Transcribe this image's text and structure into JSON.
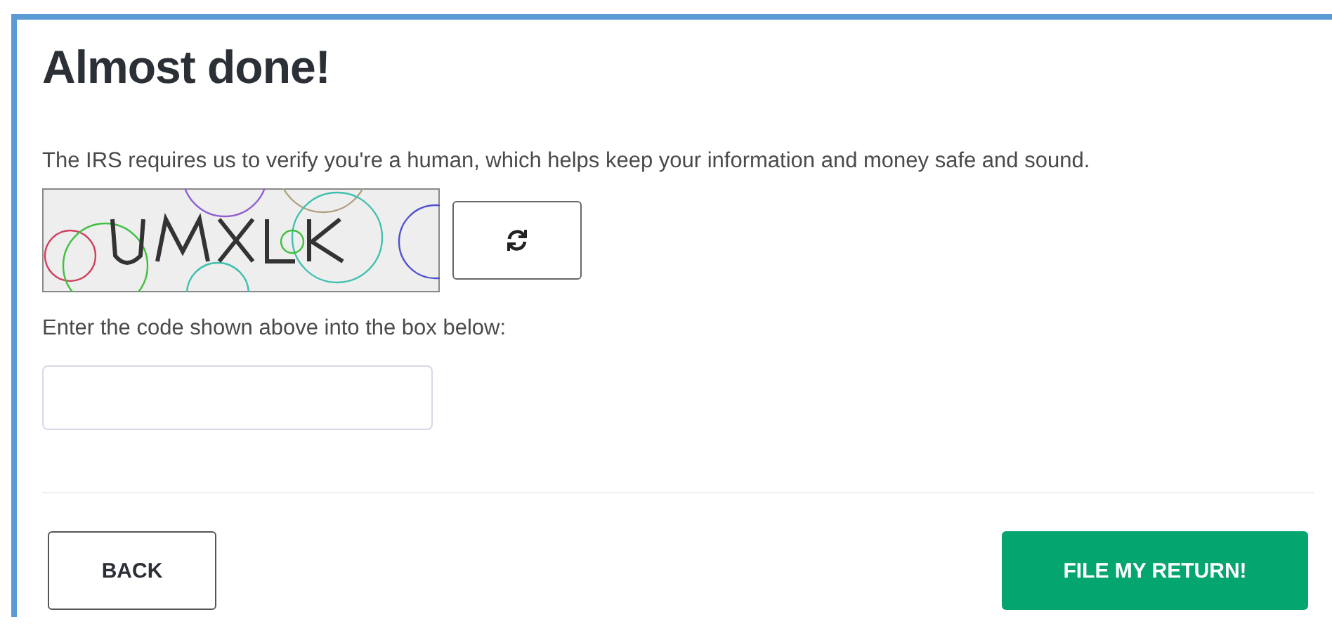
{
  "heading": "Almost done!",
  "intro": "The IRS requires us to verify you're a human, which helps keep your information and money safe and sound.",
  "code_field": {
    "label": "Enter the code shown above into the box below:"
  },
  "buttons": [
    {
      "label": "BACK",
      "kind": "secondary"
    },
    {
      "label": "FILE MY RETURN!",
      "kind": "primary"
    }
  ]
}
